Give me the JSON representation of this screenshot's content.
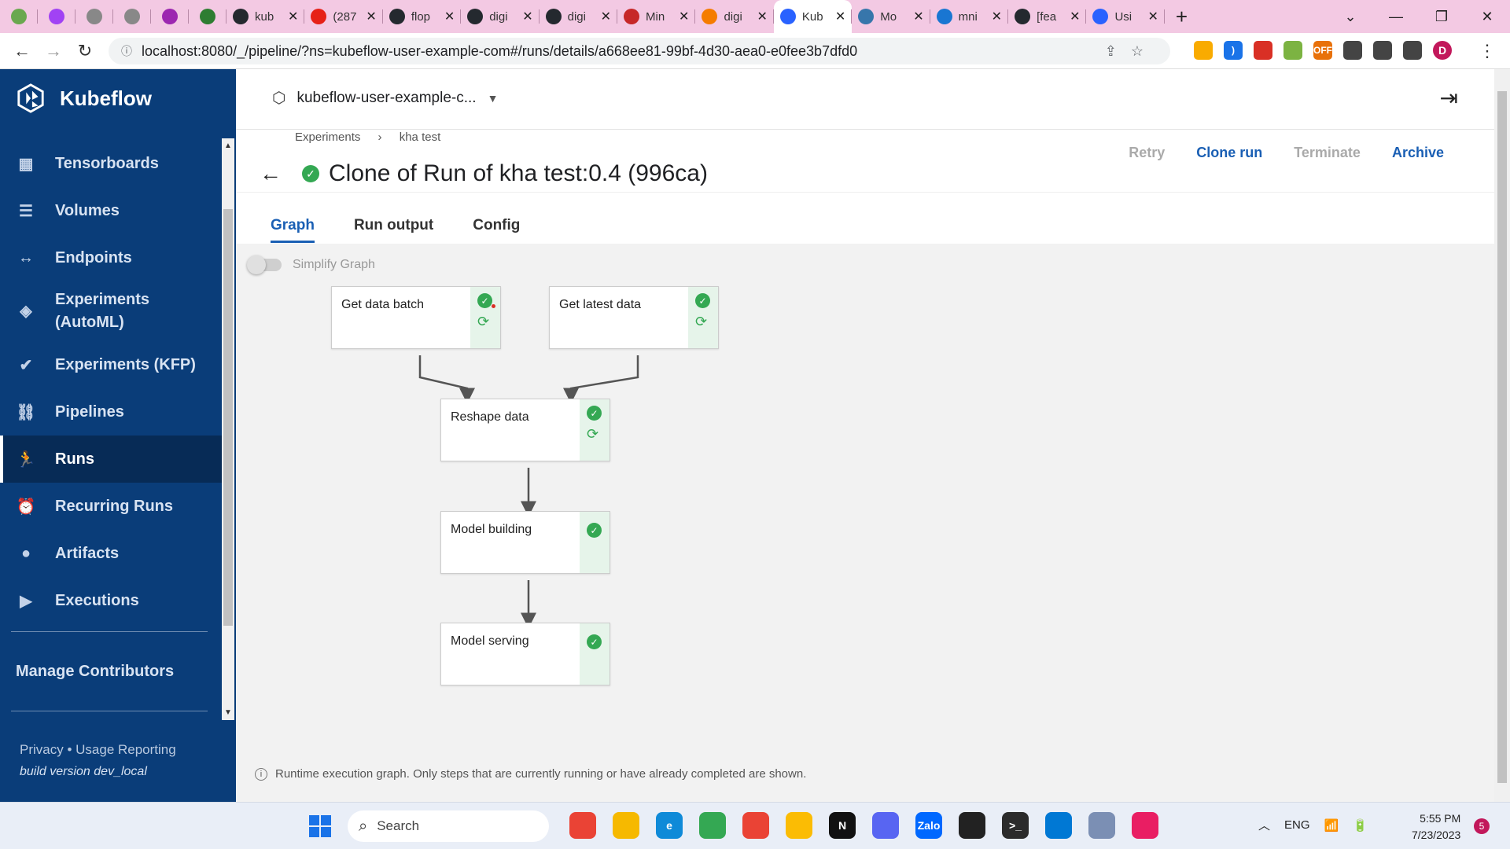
{
  "browser": {
    "tabs": [
      {
        "label": "",
        "color": "#6aa84f"
      },
      {
        "label": "",
        "color": "#a142f4"
      },
      {
        "label": "",
        "color": "#888888"
      },
      {
        "label": "",
        "color": "#888888"
      },
      {
        "label": "",
        "color": "#9c27b0"
      },
      {
        "label": "",
        "color": "#2e7d32"
      },
      {
        "label": "kub",
        "color": "#24292f"
      },
      {
        "label": "(287",
        "color": "#e62117"
      },
      {
        "label": "flop",
        "color": "#24292f"
      },
      {
        "label": "digi",
        "color": "#24292f"
      },
      {
        "label": "digi",
        "color": "#24292f"
      },
      {
        "label": "Min",
        "color": "#c62828"
      },
      {
        "label": "digi",
        "color": "#f57c00"
      },
      {
        "label": "Kub",
        "color": "#2962ff"
      },
      {
        "label": "Mo",
        "color": "#3776ab"
      },
      {
        "label": "mni",
        "color": "#1976d2"
      },
      {
        "label": "[fea",
        "color": "#24292f"
      },
      {
        "label": "Usi",
        "color": "#2962ff"
      }
    ],
    "url": "localhost:8080/_/pipeline/?ns=kubeflow-user-example-com#/runs/details/a668ee81-99bf-4d30-aea0-e0fee3b7dfd0",
    "profile_initial": "D",
    "extensions": [
      {
        "label": "",
        "color": "#f9ab00"
      },
      {
        "label": ")",
        "color": "#1a73e8"
      },
      {
        "label": "",
        "color": "#d93025"
      },
      {
        "label": "",
        "color": "#7cb342"
      },
      {
        "label": "OFF",
        "color": "#e8710a"
      },
      {
        "label": "",
        "color": "#444444"
      },
      {
        "label": "",
        "color": "#444444"
      },
      {
        "label": "",
        "color": "#444444"
      }
    ]
  },
  "sidebar": {
    "brand": "Kubeflow",
    "items": [
      {
        "label": "Tensorboards",
        "icon": "▦"
      },
      {
        "label": "Volumes",
        "icon": "☰"
      },
      {
        "label": "Endpoints",
        "icon": "↔"
      },
      {
        "label": "Experiments\n(AutoML)",
        "icon": "◈"
      },
      {
        "label": "Experiments (KFP)",
        "icon": "✔"
      },
      {
        "label": "Pipelines",
        "icon": "⛓"
      },
      {
        "label": "Runs",
        "icon": "🏃"
      },
      {
        "label": "Recurring Runs",
        "icon": "⏰"
      },
      {
        "label": "Artifacts",
        "icon": "●"
      },
      {
        "label": "Executions",
        "icon": "▶"
      }
    ],
    "manage": "Manage Contributors",
    "privacy": "Privacy  •  Usage Reporting",
    "build": "build version dev_local"
  },
  "main": {
    "namespace": "kubeflow-user-example-c...",
    "breadcrumb": [
      "Experiments",
      "›",
      "kha test"
    ],
    "title": "Clone of Run of kha test:0.4 (996ca)",
    "actions": {
      "retry": "Retry",
      "clone": "Clone run",
      "terminate": "Terminate",
      "archive": "Archive"
    },
    "tabs": [
      "Graph",
      "Run output",
      "Config"
    ],
    "simplify": "Simplify Graph",
    "nodes": [
      {
        "label": "Get data batch",
        "cached": true
      },
      {
        "label": "Get latest data",
        "cached": true
      },
      {
        "label": "Reshape data",
        "cached": true
      },
      {
        "label": "Model building",
        "cached": false
      },
      {
        "label": "Model serving",
        "cached": false
      }
    ],
    "footnote": "Runtime execution graph. Only steps that are currently running or have already completed are shown."
  },
  "taskbar": {
    "search": "Search",
    "apps": [
      {
        "label": "",
        "color": "#ea4335"
      },
      {
        "label": "",
        "color": "#f6b900"
      },
      {
        "label": "e",
        "color": "#0f8ad8"
      },
      {
        "label": "",
        "color": "#34a853"
      },
      {
        "label": "",
        "color": "#ea4335"
      },
      {
        "label": "",
        "color": "#fbbc04"
      },
      {
        "label": "N",
        "color": "#111111"
      },
      {
        "label": "",
        "color": "#5865f2"
      },
      {
        "label": "Zalo",
        "color": "#0068ff"
      },
      {
        "label": "",
        "color": "#222222"
      },
      {
        "label": ">_",
        "color": "#2b2b2b"
      },
      {
        "label": "",
        "color": "#0078d4"
      },
      {
        "label": "",
        "color": "#7b8fb4"
      },
      {
        "label": "",
        "color": "#e91e63"
      }
    ],
    "lang": "ENG",
    "time": "5:55 PM",
    "date": "7/23/2023",
    "notifications": "5"
  }
}
